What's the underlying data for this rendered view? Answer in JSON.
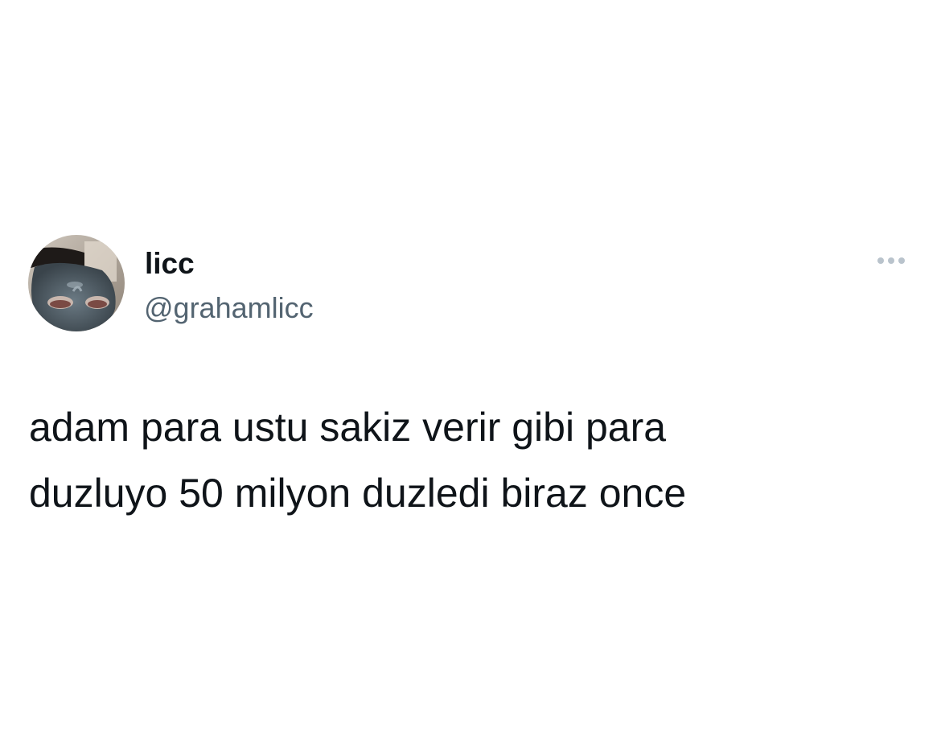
{
  "tweet": {
    "author": {
      "display_name": "licc",
      "handle": "@grahamlicc",
      "avatar_icon": "profile-photo"
    },
    "more_icon": "more-horizontal-icon",
    "text": "adam para ustu sakiz verir gibi para\nduzluyo 50 milyon duzledi biraz once"
  },
  "colors": {
    "text_primary": "#0f1419",
    "text_secondary": "#536471",
    "more_dots": "#b9c3cc",
    "background": "#ffffff"
  }
}
